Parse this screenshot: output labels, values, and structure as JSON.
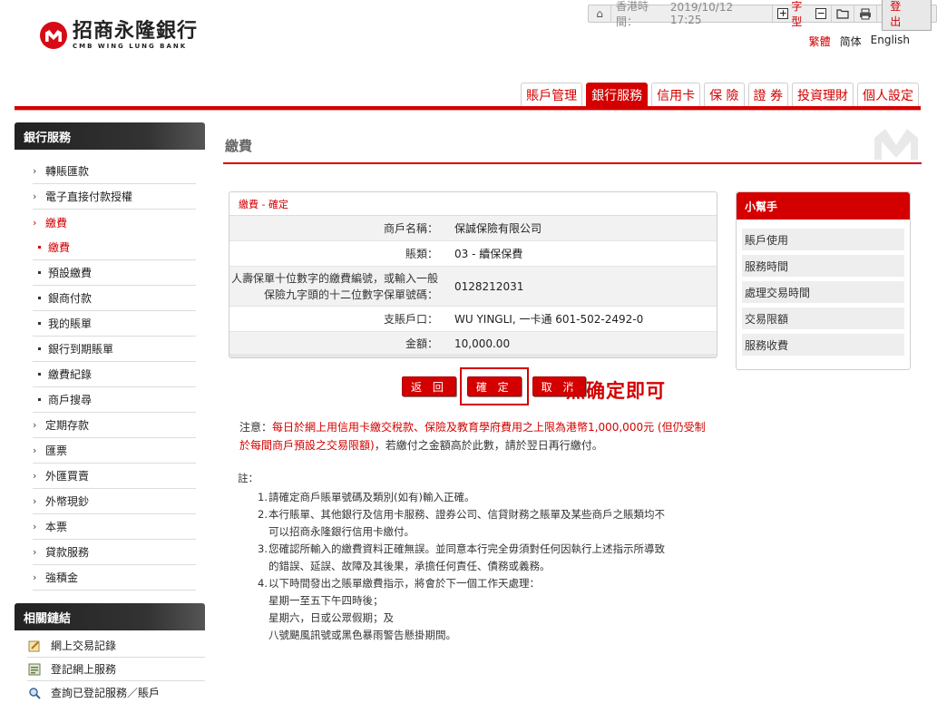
{
  "toolbar": {
    "time_label": "香港時間：",
    "time_value": "2019/10/12 17:25",
    "font_size_label": "字型",
    "logout_label": "登 出",
    "icons": [
      "home-icon",
      "font-increase-icon",
      "font-decrease-icon",
      "folder-icon",
      "print-icon"
    ]
  },
  "logo": {
    "name_cn": "招商永隆銀行",
    "name_en": "CMB WING LUNG BANK"
  },
  "language": {
    "active": "繁體",
    "simplified": "简体",
    "english": "English"
  },
  "tabs": [
    "賬戶管理",
    "銀行服務",
    "信用卡",
    "保 險",
    "證 券",
    "投資理財",
    "個人設定"
  ],
  "active_tab_index": 1,
  "sidebar": {
    "title": "銀行服務",
    "items": [
      {
        "label": "轉賬匯款"
      },
      {
        "label": "電子直接付款授權"
      },
      {
        "label": "繳費",
        "open": true,
        "children": [
          "繳費",
          "預設繳費",
          "銀商付款",
          "我的賬單",
          "銀行到期賬單",
          "繳費紀錄",
          "商戶搜尋"
        ]
      },
      {
        "label": "定期存款"
      },
      {
        "label": "匯票"
      },
      {
        "label": "外匯買賣"
      },
      {
        "label": "外幣現鈔"
      },
      {
        "label": "本票"
      },
      {
        "label": "貸款服務"
      },
      {
        "label": "強積金"
      }
    ],
    "related_title": "相關鏈結",
    "related": [
      {
        "label": "網上交易記錄",
        "icon": "notepad-icon"
      },
      {
        "label": "登記網上服務",
        "icon": "register-icon"
      },
      {
        "label": "查詢已登記服務／賬戶",
        "icon": "magnifier-icon"
      }
    ]
  },
  "page_title": "繳費",
  "confirm": {
    "title": "繳費 - 確定",
    "rows": [
      {
        "label": "商戶名稱：",
        "value": "保誠保險有限公司"
      },
      {
        "label": "賬類：",
        "value": "03 - 續保保費"
      },
      {
        "label_line1": "人壽保單十位數字的繳費編號，或輸入一般",
        "label_line2": "保險九字頭的十二位數字保單號碼：",
        "value": "0128212031"
      },
      {
        "label": "支賬戶口：",
        "value": "WU YINGLI, 一卡通 601-502-2492-0"
      },
      {
        "label": "金額：",
        "value": "10,000.00"
      }
    ]
  },
  "buttons": {
    "back": "返 回",
    "confirm": "確 定",
    "cancel": "取 消"
  },
  "annotation": "点确定即可",
  "notice": {
    "prefix": "注意：",
    "red_part": "每日於網上用信用卡繳交稅款、保險及教育學府費用之上限為港幣1,000,000元 (但仍受制於每間商戶預設之交易限額)",
    "suffix": "，若繳付之金額高於此數，請於翌日再行繳付。"
  },
  "notes": {
    "head": "註：",
    "items": [
      {
        "n": "1.",
        "lines": [
          "請確定商戶賬單號碼及類別(如有)輸入正確。"
        ]
      },
      {
        "n": "2.",
        "lines": [
          "本行賬單、其他銀行及信用卡服務、證券公司、信貸財務之賬單及某些商戶之賬類均不",
          "可以招商永隆銀行信用卡繳付。"
        ]
      },
      {
        "n": "3.",
        "lines": [
          "您確認所輸入的繳費資料正確無誤。並同意本行完全毋須對任何因執行上述指示所導致",
          "的錯誤、延誤、故障及其後果，承擔任何責任、債務或義務。"
        ]
      },
      {
        "n": "4.",
        "lines": [
          "以下時間發出之賬單繳費指示，將會於下一個工作天處理："
        ]
      }
    ],
    "time_lines": [
      "星期一至五下午四時後；",
      "星期六，日或公眾假期；及",
      "八號颶風訊號或黑色暴雨警告懸掛期間。"
    ]
  },
  "helper": {
    "title": "小幫手",
    "items": [
      "賬戶使用",
      "服務時間",
      "處理交易時間",
      "交易限額",
      "服務收費"
    ]
  },
  "colors": {
    "brand_red": "#d40000",
    "sidebar_dark": "#333333"
  }
}
